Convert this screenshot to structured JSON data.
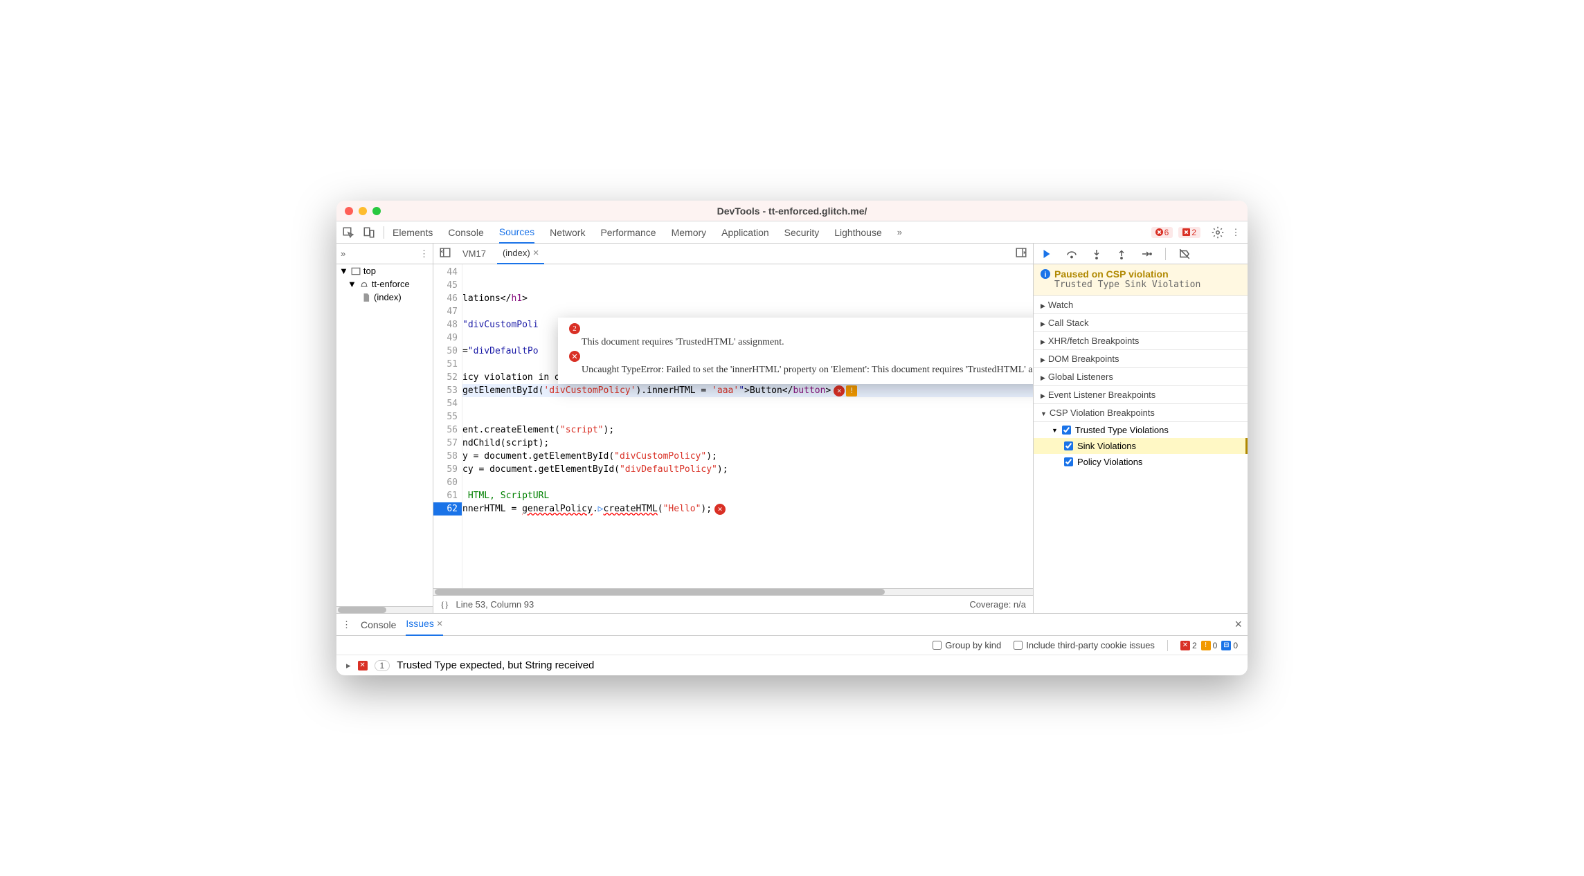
{
  "window_title": "DevTools - tt-enforced.glitch.me/",
  "main_tabs": [
    "Elements",
    "Console",
    "Sources",
    "Network",
    "Performance",
    "Memory",
    "Application",
    "Security",
    "Lighthouse"
  ],
  "main_tab_active": "Sources",
  "error_badge_count": "6",
  "warning_badge_count": "2",
  "left_tree": {
    "top": "top",
    "origin": "tt-enforce",
    "file": "(index)"
  },
  "file_tabs": {
    "vm": "VM17",
    "active": "(index)"
  },
  "lines_start": 44,
  "lines_end": 62,
  "current_line": 62,
  "highlight_line": 53,
  "code_lines": [
    "",
    "",
    "lations</h1>",
    "",
    "\"divCustomPoli",
    "",
    "=\"divDefaultPo",
    "",
    "icy violation in onClick. <button type=\"button\"",
    "getElementById('divCustomPolicy').innerHTML = 'aaa'\">Button</button>",
    "",
    "",
    "ent.createElement(\"script\");",
    "ndChild(script);",
    "y = document.getElementById(\"divCustomPolicy\");",
    "cy = document.getElementById(\"divDefaultPolicy\");",
    "",
    " HTML, ScriptURL",
    "nnerHTML = generalPolicy.createHTML(\"Hello\");"
  ],
  "tooltip": {
    "count": "2",
    "line1": "This document requires 'TrustedHTML' assignment.",
    "line2": "Uncaught TypeError: Failed to set the 'innerHTML' property on 'Element': This document requires 'TrustedHTML' assignment."
  },
  "status": {
    "position": "Line 53, Column 93",
    "coverage": "Coverage: n/a"
  },
  "pause": {
    "title": "Paused on CSP violation",
    "sub": "Trusted Type Sink Violation"
  },
  "sidebar_sections": [
    "Watch",
    "Call Stack",
    "XHR/fetch Breakpoints",
    "DOM Breakpoints",
    "Global Listeners",
    "Event Listener Breakpoints",
    "CSP Violation Breakpoints"
  ],
  "csp": {
    "trusted": "Trusted Type Violations",
    "sink": "Sink Violations",
    "policy": "Policy Violations"
  },
  "drawer": {
    "tabs": {
      "console": "Console",
      "issues": "Issues"
    },
    "group_by_kind": "Group by kind",
    "include_third_party": "Include third-party cookie issues",
    "badge_red": "2",
    "badge_yellow": "0",
    "badge_blue": "0",
    "issue1": "Trusted Type expected, but String received",
    "issue1_count": "1"
  }
}
